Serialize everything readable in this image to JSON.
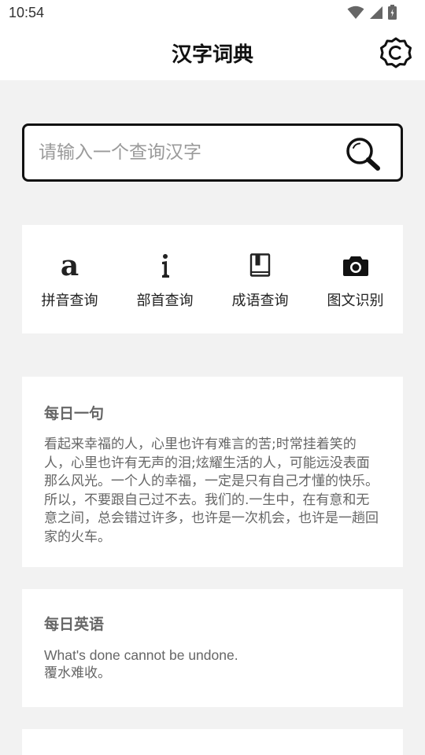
{
  "status_bar": {
    "time": "10:54",
    "icons": [
      "wifi-icon",
      "cell-signal-icon",
      "battery-icon"
    ]
  },
  "header": {
    "title": "汉字词典",
    "settings_icon": "settings-icon"
  },
  "search": {
    "placeholder": "请输入一个查询汉字",
    "value": "",
    "button_icon": "search-icon"
  },
  "quick_actions": [
    {
      "label": "拼音查询",
      "icon": "pinyin-a-icon"
    },
    {
      "label": "部首查询",
      "icon": "radical-icon"
    },
    {
      "label": "成语查询",
      "icon": "book-icon"
    },
    {
      "label": "图文识别",
      "icon": "camera-icon"
    }
  ],
  "daily_sentence": {
    "title": "每日一句",
    "text": "看起来幸福的人，心里也许有难言的苦;时常挂着笑的人，心里也许有无声的泪;炫耀生活的人，可能远没表面那么风光。一个人的幸福，一定是只有自己才懂的快乐。所以，不要跟自己过不去。我们的.一生中，在有意和无意之间，总会错过许多，也许是一次机会，也许是一趟回家的火车。"
  },
  "daily_english": {
    "title": "每日英语",
    "english": "What's done cannot be undone.",
    "chinese": "覆水难收。"
  },
  "colors": {
    "page_background": "#f2f2f2",
    "card_background": "#ffffff",
    "primary_text": "#222222",
    "secondary_text": "#666666",
    "placeholder_text": "#9a9a9a",
    "search_border": "#111111"
  }
}
